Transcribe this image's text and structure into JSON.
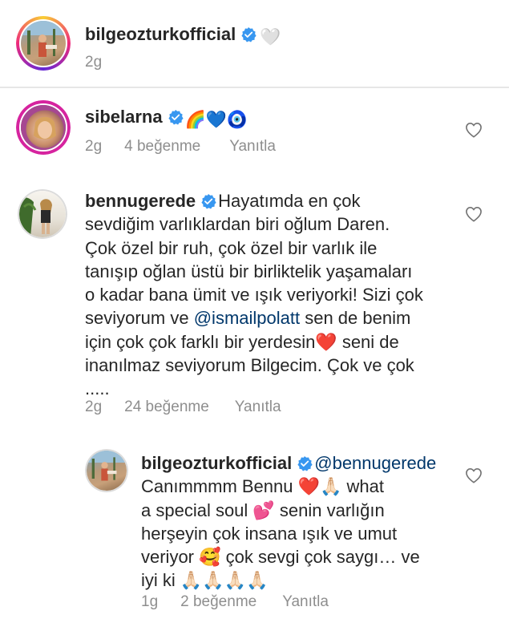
{
  "caption": {
    "username": "bilgeozturkofficial",
    "emoji": "🤍",
    "time": "2g"
  },
  "comments": [
    {
      "username": "sibelarna",
      "text": "🌈💙🧿",
      "time": "2g",
      "likes": "4 beğenme",
      "reply": "Yanıtla"
    },
    {
      "username": "bennugerede",
      "lines": [
        "Hayatımda en çok",
        "sevdiğim varlıklardan biri oğlum Daren.",
        "Çok özel bir ruh, çok özel bir varlık ile",
        "tanışıp oğlan üstü bir birliktelik yaşamaları",
        "o kadar bana ümit ve ışık veriyorki! Sizi çok",
        "seviyorum ve ",
        "@ismailpolatt",
        " sen de benim",
        "için çok çok farklı bir yerdesin❤️ seni de",
        "inanılmaz seviyorum Bilgecim. Çok ve çok",
        "....."
      ],
      "time": "2g",
      "likes": "24 beğenme",
      "reply": "Yanıtla"
    }
  ],
  "reply": {
    "username": "bilgeozturkofficial",
    "mention": "@bennugerede",
    "lines": [
      "Canımmmm Bennu ❤️🙏🏻 what",
      "a special soul 💕 senin varlığın",
      "herşeyin çok insana ışık ve umut",
      "veriyor 🥰 çok sevgi çok saygı… ve",
      "iyi ki 🙏🏻🙏🏻🙏🏻🙏🏻"
    ],
    "time": "1g",
    "likes": "2 beğenme",
    "reply_label": "Yanıtla"
  },
  "colors": {
    "verified": "#3897f0",
    "meta": "#8e8e8e",
    "mention": "#00376b",
    "story_ring": "#d6249f"
  }
}
